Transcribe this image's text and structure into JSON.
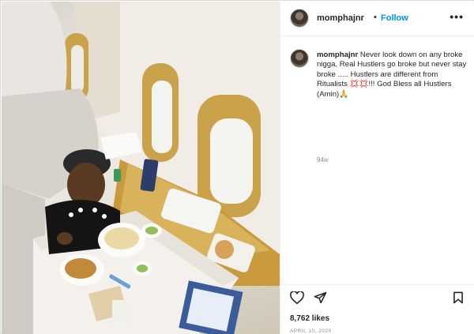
{
  "post": {
    "username": "momphajnr",
    "follow_label": "Follow",
    "separator": "•",
    "more_label": "•••",
    "caption_username": "momphajnr",
    "caption": "Never look down on any broke nigga, Real Hustlers go broke but never stay broke ..... Hustlers are different from Ritualists 💢💢!!! God Bless all Hustlers (Amin)🙏",
    "time_ago": "94w",
    "likes": "8,762 likes",
    "date": "APRIL 10, 2020"
  },
  "icons": {
    "avatar": "profile-avatar",
    "more": "more-options-icon",
    "like": "heart-icon",
    "share": "paper-plane-icon",
    "save": "bookmark-icon"
  },
  "colors": {
    "link_blue": "#0095f6",
    "text": "#262626",
    "muted": "#8e8e8e",
    "border": "#dbdbdb"
  }
}
